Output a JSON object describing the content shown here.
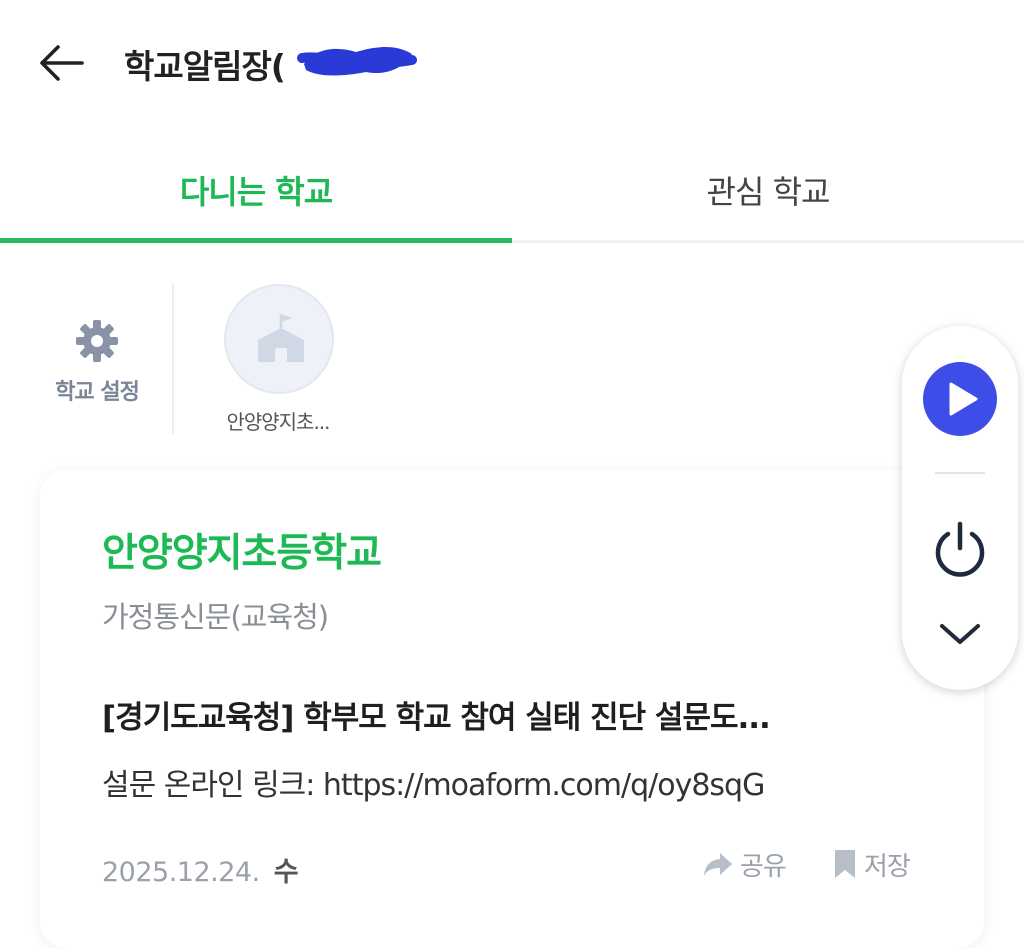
{
  "header": {
    "title": "학교알림장("
  },
  "tabs": [
    {
      "label": "다니는 학교",
      "active": true
    },
    {
      "label": "관심 학교",
      "active": false
    }
  ],
  "school_settings": {
    "label": "학교 설정"
  },
  "school_chips": [
    {
      "label": "안양양지초..."
    }
  ],
  "notice": {
    "school_name": "안양양지초등학교",
    "category": "가정통신문(교육청)",
    "title": "[경기도교육청] 학부모 학교 참여 실태 진단 설문도...",
    "body": "설문 온라인 링크: https://moaform.com/q/oy8sqG",
    "date": "2025.12.24.",
    "day": "수",
    "share_label": "공유",
    "save_label": "저장"
  },
  "colors": {
    "accent_green": "#1db954",
    "play_blue": "#3d4ee8",
    "redaction_blue": "#2a3ad6",
    "muted": "#9aa1ab"
  },
  "icons": [
    "back-arrow-icon",
    "gear-icon",
    "school-icon",
    "play-icon",
    "power-icon",
    "chevron-down-icon",
    "share-icon",
    "bookmark-icon"
  ]
}
